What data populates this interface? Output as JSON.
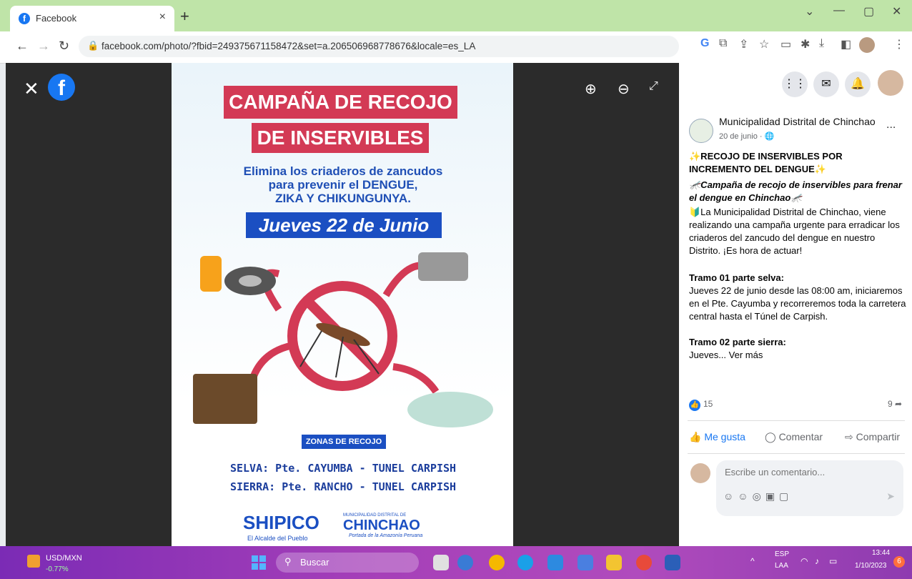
{
  "browser": {
    "tab_title": "Facebook",
    "tab_close": "×",
    "new_tab": "+",
    "url": "facebook.com/photo/?fbid=249375671158472&set=a.206506968778676&locale=es_LA",
    "favicon": "facebook-icon"
  },
  "poster": {
    "banner_line1": "CAMPAÑA DE RECOJO",
    "banner_line2": "DE INSERVIBLES",
    "subtitle_line1": "Elimina los criaderos de zancudos",
    "subtitle_line2": "para prevenir el DENGUE,",
    "subtitle_line3": "ZIKA Y CHIKUNGUNYA.",
    "date": "Jueves 22 de Junio",
    "zones_title": "ZONAS DE RECOJO",
    "zone1": "SELVA: Pte. CAYUMBA - TUNEL CARPISH",
    "zone2": "SIERRA: Pte. RANCHO - TUNEL CARPISH",
    "logo1": "SHIPICO",
    "logo1_sub": "El Alcalde del Pueblo",
    "logo2_top": "MUNICIPALIDAD DISTRITAL DE",
    "logo2": "CHINCHAO",
    "logo2_sub": "Portada de la Amazonía Peruana"
  },
  "post": {
    "page_name": "Municipalidad Distrital de Chinchao",
    "posted": "20 de junio · 🌐",
    "more": "...",
    "headline": "✨RECOJO DE INSERVIBLES POR INCREMENTO DEL DENGUE✨",
    "subhead": "🦟Campaña de recojo de inservibles para frenar el dengue en Chinchao🦟",
    "body": "🔰La Municipalidad Distrital de Chinchao, viene realizando una campaña urgente para erradicar los criaderos del zancudo del dengue en nuestro Distrito. ¡Es hora de actuar!",
    "tramo1_title": "Tramo 01 parte selva:",
    "tramo1_body": "Jueves 22 de junio desde las 08:00 am, iniciaremos en el Pte. Cayumba y recorreremos toda la carretera central hasta el Túnel de Carpish.",
    "tramo2_title": "Tramo 02 parte sierra:",
    "tramo2_body": "Jueves... Ver más",
    "likes": "15",
    "shares": "9",
    "like_label": "Me gusta",
    "comment_label": "Comentar",
    "share_label": "Compartir",
    "comment_placeholder": "Escribe un comentario..."
  },
  "taskbar": {
    "ticker_name": "USD/MXN",
    "ticker_value": "-0.77%",
    "search_placeholder": "Buscar",
    "lang1": "ESP",
    "lang2": "LAA",
    "time": "13:44",
    "date": "1/10/2023",
    "notif": "6"
  },
  "colors": {
    "brand": "#1877f2",
    "banner": "#d33a55",
    "poster_blue": "#1b4fc2"
  }
}
